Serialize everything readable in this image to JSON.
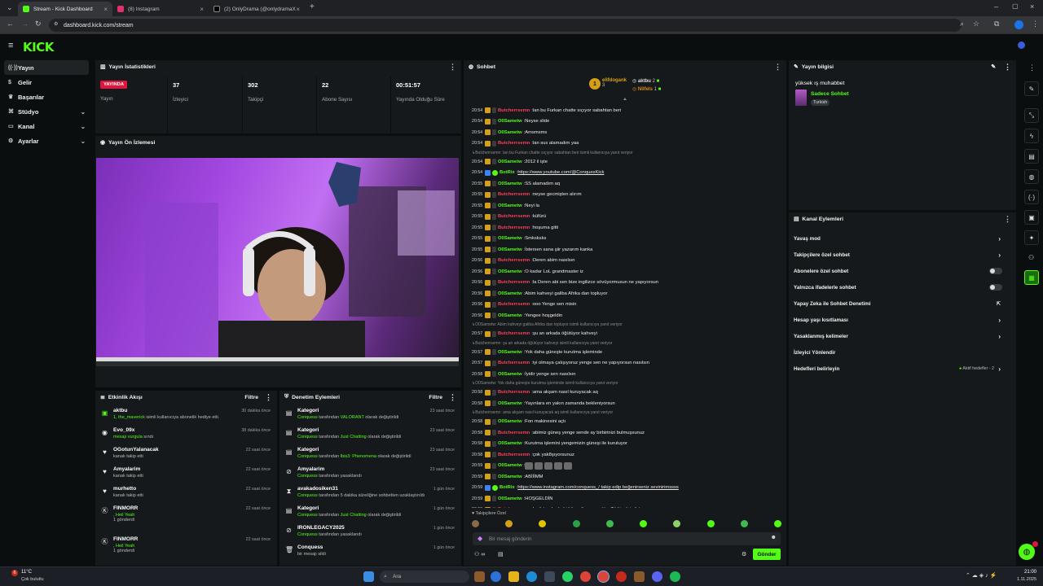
{
  "browser": {
    "tabs": [
      {
        "label": "Stream - Kick Dashboard",
        "active": true,
        "color": "#53fc18"
      },
      {
        "label": "(8) Instagram",
        "active": false,
        "color": "#e1306c"
      },
      {
        "label": "(2) OnlyDrama (@onlydramaX)",
        "active": false,
        "color": "#ffffff"
      }
    ],
    "url": "dashboard.kick.com/stream"
  },
  "app": {
    "logo": "KICK",
    "brand_color": "#53fc18"
  },
  "sidebar": {
    "items": [
      {
        "label": "Yayın",
        "icon": "broadcast-icon",
        "active": true,
        "chevron": false
      },
      {
        "label": "Gelir",
        "icon": "dollar-icon",
        "active": false,
        "chevron": false
      },
      {
        "label": "Başarılar",
        "icon": "trophy-icon",
        "active": false,
        "chevron": false
      },
      {
        "label": "Stüdyo",
        "icon": "studio-icon",
        "active": false,
        "chevron": true
      },
      {
        "label": "Kanal",
        "icon": "channel-icon",
        "active": false,
        "chevron": true
      },
      {
        "label": "Ayarlar",
        "icon": "settings-icon",
        "active": false,
        "chevron": true
      }
    ]
  },
  "stats": {
    "title": "Yayın İstatistikleri",
    "live_badge": "YAYINDA",
    "live_label": "Yayın",
    "items": [
      {
        "value": "37",
        "label": "İzleyici"
      },
      {
        "value": "302",
        "label": "Takipçi"
      },
      {
        "value": "22",
        "label": "Abone Sayısı"
      },
      {
        "value": "00:51:57",
        "label": "Yayında Olduğu Süre"
      }
    ]
  },
  "preview": {
    "title": "Yayın Ön İzlemesi"
  },
  "activity": {
    "title": "Etkinlik Akışı",
    "filter": "Filtre",
    "rows": [
      {
        "name": "aktbu",
        "desc1": "1, the_maverick",
        "desc2": " isimli kullanıcıya abonelik hediye etti.",
        "time": "30 dakika önce",
        "icon": "gift-icon"
      },
      {
        "name": "Evo_09x",
        "desc1": "mesajı vurgula",
        "desc2": " sındı",
        "time": "38 dakika önce",
        "icon": "highlight-icon"
      },
      {
        "name": "OGotunYalanacak",
        "desc1": "",
        "desc2": "kanalı takip etti",
        "time": "22 saat önce",
        "icon": "heart-icon"
      },
      {
        "name": "Amyalarim",
        "desc1": "",
        "desc2": "kanalı takip etti",
        "time": "22 saat önce",
        "icon": "heart-icon"
      },
      {
        "name": "murhetto",
        "desc1": "",
        "desc2": "kanalı takip etti",
        "time": "22 saat önce",
        "icon": "heart-icon"
      },
      {
        "name": "FINMORR",
        "desc1": ", Heil Yeah",
        "desc2": "1 gönderdi",
        "time": "22 saat önce",
        "icon": "kick-k-icon"
      },
      {
        "name": "FINMORR",
        "desc1": ", Heil Yeah",
        "desc2": "1 gönderdi",
        "time": "22 saat önce",
        "icon": "kick-k-icon"
      }
    ]
  },
  "moderation": {
    "title": "Denetim Eylemleri",
    "filter": "Filtre",
    "rows": [
      {
        "name": "Kategori",
        "user": "Conquess",
        "mid": " tarafından ",
        "val": "VALORANT",
        "end": " olarak değiştirildi",
        "time": "23 saat önce",
        "icon": "category-icon"
      },
      {
        "name": "Kategori",
        "user": "Conquess",
        "mid": " tarafından ",
        "val": "Just Chatting",
        "end": " olarak değiştirildi",
        "time": "23 saat önce",
        "icon": "category-icon"
      },
      {
        "name": "Kategori",
        "user": "Conquess",
        "mid": " tarafından ",
        "val": "Ibis3: Phenomena",
        "end": " olarak değiştirildi",
        "time": "23 saat önce",
        "icon": "category-icon"
      },
      {
        "name": "Amyalarim",
        "user": "Conquess",
        "mid": " tarafından yasaklandı",
        "val": "",
        "end": "",
        "time": "23 saat önce",
        "icon": "ban-icon"
      },
      {
        "name": "avakadosiken31",
        "user": "Conquess",
        "mid": " tarafından 5 dakika süreliğine sohbetten uzaklaştırıldı",
        "val": "",
        "end": "",
        "time": "1 gün önce",
        "icon": "timeout-icon"
      },
      {
        "name": "Kategori",
        "user": "Conquess",
        "mid": " tarafından ",
        "val": "Just Chatting",
        "end": " olarak değiştirildi",
        "time": "1 gün önce",
        "icon": "category-icon"
      },
      {
        "name": "IRONLEGACY2025",
        "user": "Conquess",
        "mid": " tarafından yasaklandı",
        "val": "",
        "end": "",
        "time": "1 gün önce",
        "icon": "ban-icon"
      },
      {
        "name": "Conquess",
        "user": "",
        "mid": "bir mesajı sildi",
        "val": "",
        "end": "",
        "time": "1 gün önce",
        "icon": "trash-icon"
      }
    ]
  },
  "chat": {
    "title": "Sohbet",
    "top_gifters": [
      {
        "name": "elifdogank",
        "count": "3"
      },
      {
        "name": "aktbu",
        "count": "2"
      },
      {
        "name": "Nilfels",
        "count": "1"
      }
    ],
    "messages": [
      {
        "time": "20:54",
        "user": "Butcherrsemn",
        "color": "#ff3d5a",
        "text": "lan bu Furkan chatte sıçıyor sabahtan beri"
      },
      {
        "time": "20:54",
        "user": "O0Sametw",
        "color": "#53fc18",
        "text": "Neyse slide"
      },
      {
        "time": "20:54",
        "user": "O0Sametw",
        "color": "#53fc18",
        "text": "Amsmsms"
      },
      {
        "time": "20:54",
        "user": "Butcherrsemn",
        "color": "#ff3d5a",
        "text": "lan sus alamadım yaa"
      },
      {
        "reply": "Butcherrsemn: lan bu Furkan chatte sıçıyor sabahtan beri isimli kullanıcıya yanıt veriyor"
      },
      {
        "time": "20:54",
        "user": "O0Sametw",
        "color": "#53fc18",
        "text": "2012 il işte"
      },
      {
        "time": "20:54",
        "user": "BotRix",
        "color": "#53fc18",
        "text": "https://www.youtube.com/@ConquesKick"
      },
      {
        "time": "20:55",
        "user": "O0Sametw",
        "color": "#53fc18",
        "text": "SS alamadım aq"
      },
      {
        "time": "20:55",
        "user": "Butcherrsemn",
        "color": "#ff3d5a",
        "text": "neyse gecmişten alırım"
      },
      {
        "time": "20:55",
        "user": "O0Sametw",
        "color": "#53fc18",
        "text": "Neyi la"
      },
      {
        "time": "20:55",
        "user": "Butcherrsemn",
        "color": "#ff3d5a",
        "text": "küfürü"
      },
      {
        "time": "20:55",
        "user": "Butcherrsemn",
        "color": "#ff3d5a",
        "text": "hoşuma gitti"
      },
      {
        "time": "20:55",
        "user": "O0Sametw",
        "color": "#53fc18",
        "text": "Smksksks"
      },
      {
        "time": "20:55",
        "user": "O0Sametw",
        "color": "#53fc18",
        "text": "İstersen sana şiir yazarım kanka"
      },
      {
        "time": "20:56",
        "user": "Butcherrsemn",
        "color": "#ff3d5a",
        "text": "Deren abim nasılsın"
      },
      {
        "time": "20:56",
        "user": "O0Sametw",
        "color": "#53fc18",
        "text": "O kadar LoL grandmaster iz"
      },
      {
        "time": "20:56",
        "user": "Butcherrsemn",
        "color": "#ff3d5a",
        "text": "la Deren abi sen bize ingilizce sövüyormusun ne yapıyorsun"
      },
      {
        "time": "20:56",
        "user": "O0Sametw",
        "color": "#53fc18",
        "text": "Abim kahveyi galiba Afrika dan topluyor"
      },
      {
        "time": "20:56",
        "user": "Butcherrsemn",
        "color": "#ff3d5a",
        "text": "ooo Yenge sen misin"
      },
      {
        "time": "20:56",
        "user": "O0Sametw",
        "color": "#53fc18",
        "text": "Yengee hoşgeldin"
      },
      {
        "reply": "O0Sametw: Abim kahveyi galiba Afrika dan topluyor isimli kullanıcıya yanıt veriyor"
      },
      {
        "time": "20:57",
        "user": "Butcherrsemn",
        "color": "#ff3d5a",
        "text": "şu an arkada öğütüyor kahveyi"
      },
      {
        "reply": "Butcherrsemn: şu an arkada öğütüyor kahveyi isimli kullanıcıya yanıt veriyor"
      },
      {
        "time": "20:57",
        "user": "O0Sametw",
        "color": "#53fc18",
        "text": "Yok daha güneşte kurutma işleminde"
      },
      {
        "time": "20:57",
        "user": "Butcherrsemn",
        "color": "#ff3d5a",
        "text": "iyi olmaya çalışıyoruz yenge sen ne yapıyorsun nasılsın"
      },
      {
        "time": "20:58",
        "user": "O0Sametw",
        "color": "#53fc18",
        "text": "İyidir yenge sen nasılsın"
      },
      {
        "reply": "O0Sametw: Yok daha güneşte kurutma işleminde isimli kullanıcıya yanıt veriyor"
      },
      {
        "time": "20:58",
        "user": "Butcherrsemn",
        "color": "#ff3d5a",
        "text": "ama akşam nasıl kuruyacak aq"
      },
      {
        "time": "20:58",
        "user": "O0Sametw",
        "color": "#53fc18",
        "text": "Yayınlara en yakın zamanda bekleniyorsun"
      },
      {
        "reply": "Butcherrsemn: ama akşam nasıl kuruyacak aq isimli kullanıcıya yanıt veriyor"
      },
      {
        "time": "20:58",
        "user": "O0Sametw",
        "color": "#53fc18",
        "text": "Fon makinesini açtı"
      },
      {
        "time": "20:58",
        "user": "Butcherrsemn",
        "color": "#ff3d5a",
        "text": "abimiz güneş yenge sende ay birbirinizi bulmuşsunuz"
      },
      {
        "time": "20:58",
        "user": "O0Sametw",
        "color": "#53fc18",
        "text": "Kurutma işlemini yengemizin güneşi ile kurutuyor"
      },
      {
        "time": "20:58",
        "user": "Butcherrsemn",
        "color": "#ff3d5a",
        "text": "çok yak8şıyorsunuz"
      },
      {
        "time": "20:59",
        "user": "O0Sametw",
        "color": "#53fc18",
        "text": "",
        "emotes": 5
      },
      {
        "time": "20:59",
        "user": "O0Sametw",
        "color": "#53fc18",
        "text": "ABİİİMM"
      },
      {
        "time": "20:59",
        "user": "BotRix",
        "color": "#53fc18",
        "text": "https://www.instagram.com/conquess_/ takip edip beğenirseniz sevinirimssss"
      },
      {
        "time": "20:59",
        "user": "O0Sametw",
        "color": "#53fc18",
        "text": "HOŞGELDİN"
      },
      {
        "time": "20:59",
        "user": "Butcherrsemn",
        "color": "#ff3d5a",
        "text": "bu faturalarda bi bitmedi , yenge tüm Türkiye'nin faturası mı"
      }
    ],
    "followers_only": "Takipçilere Özel",
    "input_placeholder": "Bir mesaj gönderin",
    "send": "Gönder"
  },
  "stream_info": {
    "title": "Yayın bilgisi",
    "stream_title": "yüksek ış muhabbet",
    "category": "Sadece Sohbet",
    "language": "Turkish"
  },
  "channel_actions": {
    "title": "Kanal Eylemleri",
    "items": [
      {
        "label": "Yavaş mod",
        "type": "chevron"
      },
      {
        "label": "Takipçilere özel sohbet",
        "type": "chevron"
      },
      {
        "label": "Abonelere özel sohbet",
        "type": "toggle"
      },
      {
        "label": "Yalnızca ifadelerle sohbet",
        "type": "toggle"
      },
      {
        "label": "Yapay Zeka ile Sohbet Denetimi",
        "type": "external"
      },
      {
        "label": "Hesap yaşı kısıtlaması",
        "type": "chevron"
      },
      {
        "label": "Yasaklanmış kelimeler",
        "type": "chevron"
      },
      {
        "label": "İzleyici Yönlendir",
        "type": "none"
      },
      {
        "label": "Hedefleri belirleyin",
        "type": "goal"
      }
    ],
    "goal_status": "Aktif hedefler - 2"
  },
  "taskbar": {
    "weather_temp": "11°C",
    "weather_desc": "Çok bulutlu",
    "search_placeholder": "Ara",
    "time": "21:00",
    "date": "1.11.2025",
    "notification_count": "6"
  }
}
